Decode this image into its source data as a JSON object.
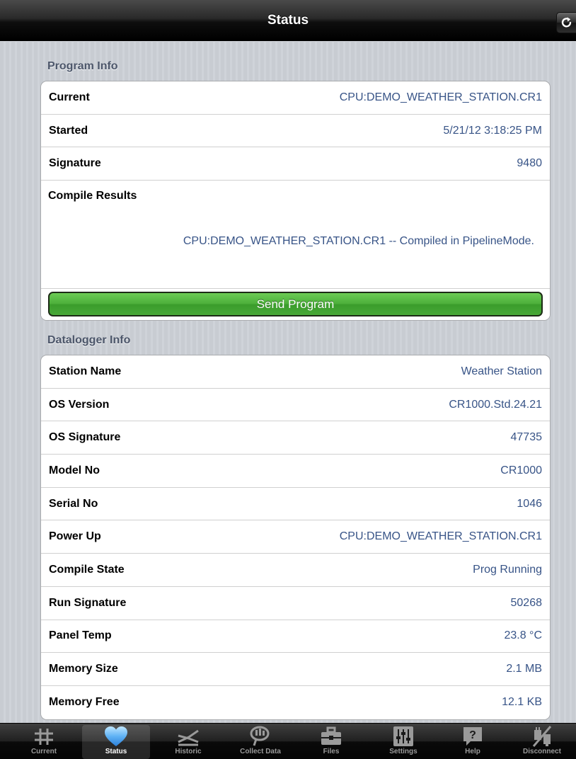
{
  "navbar": {
    "title": "Status",
    "refresh_icon": "refresh-icon"
  },
  "program_info": {
    "header": "Program Info",
    "rows": [
      {
        "label": "Current",
        "value": "CPU:DEMO_WEATHER_STATION.CR1"
      },
      {
        "label": "Started",
        "value": "5/21/12 3:18:25 PM"
      },
      {
        "label": "Signature",
        "value": "9480"
      }
    ],
    "compile_label": "Compile Results",
    "compile_value": "CPU:DEMO_WEATHER_STATION.CR1 -- Compiled in PipelineMode.",
    "send_button": "Send Program"
  },
  "datalogger_info": {
    "header": "Datalogger Info",
    "rows": [
      {
        "label": "Station Name",
        "value": "Weather Station"
      },
      {
        "label": "OS Version",
        "value": "CR1000.Std.24.21"
      },
      {
        "label": "OS Signature",
        "value": "47735"
      },
      {
        "label": "Model No",
        "value": "CR1000"
      },
      {
        "label": "Serial No",
        "value": "1046"
      },
      {
        "label": "Power Up",
        "value": "CPU:DEMO_WEATHER_STATION.CR1"
      },
      {
        "label": "Compile State",
        "value": "Prog Running"
      },
      {
        "label": "Run Signature",
        "value": "50268"
      },
      {
        "label": "Panel Temp",
        "value": "23.8 °C"
      },
      {
        "label": "Memory Size",
        "value": "2.1 MB"
      },
      {
        "label": "Memory Free",
        "value": "12.1 KB"
      }
    ]
  },
  "tabbar": {
    "active": "Status",
    "tabs": [
      {
        "label": "Current",
        "icon": "hash-icon"
      },
      {
        "label": "Status",
        "icon": "heart-icon"
      },
      {
        "label": "Historic",
        "icon": "historic-icon"
      },
      {
        "label": "Collect Data",
        "icon": "collect-icon"
      },
      {
        "label": "Files",
        "icon": "briefcase-icon"
      },
      {
        "label": "Settings",
        "icon": "sliders-icon"
      },
      {
        "label": "Help",
        "icon": "help-icon"
      },
      {
        "label": "Disconnect",
        "icon": "disconnect-icon"
      }
    ]
  }
}
